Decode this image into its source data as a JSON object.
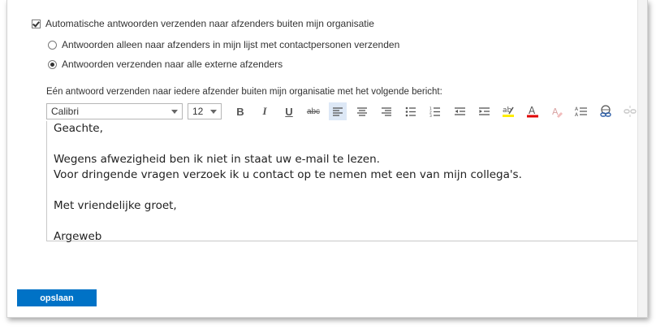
{
  "settings": {
    "auto_reply_external_label": "Automatische antwoorden verzenden naar afzenders buiten mijn organisatie",
    "option_contacts_label": "Antwoorden alleen naar afzenders in mijn lijst met contactpersonen verzenden",
    "option_all_external_label": "Antwoorden verzenden naar alle externe afzenders",
    "message_label": "Eén antwoord verzenden naar iedere afzender buiten mijn organisatie met het volgende bericht:"
  },
  "toolbar": {
    "font_family": "Calibri",
    "font_size": "12",
    "bold_glyph": "B",
    "italic_glyph": "I",
    "underline_glyph": "U",
    "strike_glyph": "abc",
    "icons": [
      "align-left-icon",
      "align-center-icon",
      "align-right-icon",
      "bullet-list-icon",
      "numbered-list-icon",
      "decrease-indent-icon",
      "increase-indent-icon",
      "highlight-icon",
      "font-color-icon",
      "clear-format-icon",
      "paragraph-spacing-icon",
      "insert-link-icon",
      "remove-link-icon"
    ],
    "highlight_color": "#ffee00",
    "font_color": "#e00000"
  },
  "editor": {
    "lines": [
      "Geachte,",
      "",
      "Wegens afwezigheid ben ik niet in staat uw e-mail te lezen.",
      "Voor dringende vragen verzoek ik u contact op te nemen met een van mijn collega's.",
      "",
      "Met vriendelijke groet,",
      "",
      "Argeweb"
    ]
  },
  "actions": {
    "save_label": "opslaan"
  },
  "colors": {
    "accent": "#0072c6"
  }
}
